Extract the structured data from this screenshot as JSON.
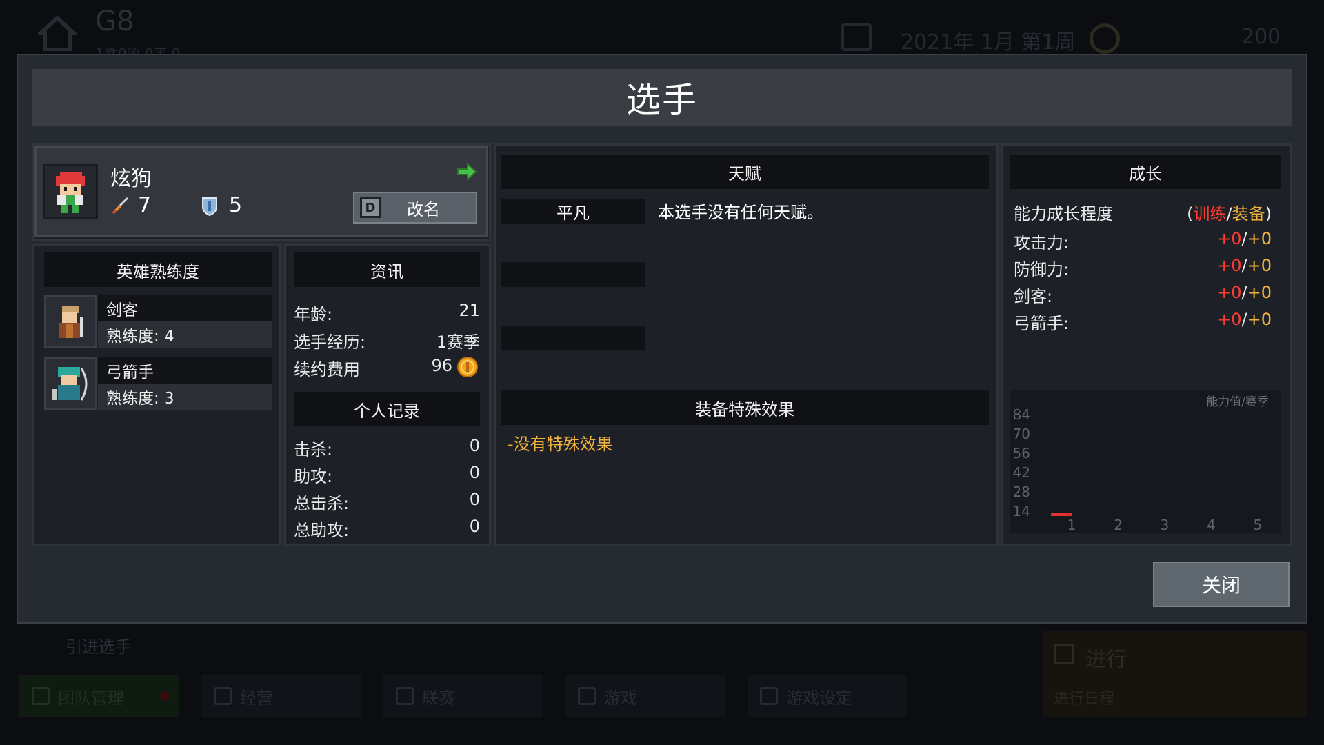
{
  "background": {
    "team_name": "G8",
    "team_sub": "1胜0败 0平 0",
    "date": "2021年 1月 第1周",
    "money": "200",
    "recruit": "引进选手",
    "tabs": [
      {
        "label": "团队管理",
        "icon": "shield-icon"
      },
      {
        "label": "经营",
        "icon": "clipboard-icon"
      },
      {
        "label": "联赛",
        "icon": "trophy-icon"
      },
      {
        "label": "游戏",
        "icon": "gamepad-icon"
      },
      {
        "label": "游戏设定",
        "icon": "gear-icon"
      }
    ],
    "progress": {
      "title": "进行",
      "subtitle": "进行日程"
    }
  },
  "modal": {
    "title": "选手",
    "player": {
      "name": "炫狗",
      "attack": "7",
      "defense": "5",
      "rename_key": "D",
      "rename_label": "改名"
    },
    "hero_mastery": {
      "header": "英雄熟练度",
      "items": [
        {
          "name": "剑客",
          "mastery": "熟练度: 4"
        },
        {
          "name": "弓箭手",
          "mastery": "熟练度: 3"
        }
      ]
    },
    "info": {
      "header": "资讯",
      "rows": [
        {
          "label": "年龄:",
          "value": "21"
        },
        {
          "label": "选手经历:",
          "value": "1赛季"
        },
        {
          "label": "续约费用",
          "value": "96"
        }
      ]
    },
    "records": {
      "header": "个人记录",
      "rows": [
        {
          "label": "击杀:",
          "value": "0"
        },
        {
          "label": "助攻:",
          "value": "0"
        },
        {
          "label": "总击杀:",
          "value": "0"
        },
        {
          "label": "总助攻:",
          "value": "0"
        }
      ]
    },
    "talent": {
      "header": "天赋",
      "name": "平凡",
      "description": "本选手没有任何天赋。"
    },
    "equipment": {
      "header": "装备特殊效果",
      "none": "-没有特殊效果"
    },
    "growth": {
      "header": "成长",
      "legend_label": "能力成长程度",
      "legend_open": "(",
      "legend_train": "训练",
      "legend_slash": "/",
      "legend_equip": "装备",
      "legend_close": ")",
      "rows": [
        {
          "label": "攻击力:",
          "train": "+0",
          "equip": "+0"
        },
        {
          "label": "防御力:",
          "train": "+0",
          "equip": "+0"
        },
        {
          "label": "剑客:",
          "train": "+0",
          "equip": "+0"
        },
        {
          "label": "弓箭手:",
          "train": "+0",
          "equip": "+0"
        }
      ]
    },
    "close_label": "关闭"
  },
  "colors": {
    "train": "#ff3b30",
    "equip": "#f2b33d",
    "line": "#e03030"
  },
  "chart_data": {
    "type": "line",
    "title": "能力值/赛季",
    "xlabel": "",
    "ylabel": "",
    "x": [
      1,
      2,
      3,
      4,
      5
    ],
    "ylim": [
      14,
      84
    ],
    "yticks": [
      84,
      70,
      56,
      42,
      28,
      14
    ],
    "series": [
      {
        "values": [
          12
        ]
      }
    ],
    "grid": false
  }
}
